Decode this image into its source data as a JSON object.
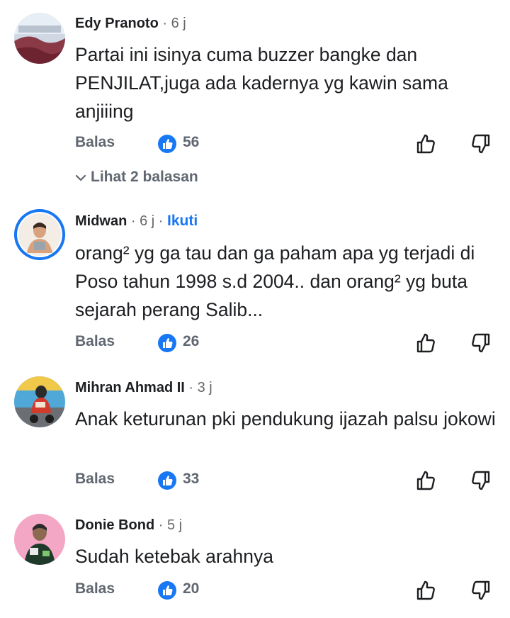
{
  "comments": [
    {
      "name": "Edy Pranoto",
      "time": "· 6 j",
      "text": "Partai ini isinya cuma buzzer bangke dan PENJILAT,juga ada kadernya yg kawin sama anjiiing",
      "reply_label": "Balas",
      "likes": "56",
      "avatar_icon": "avatar-landscape",
      "replies_link": "Lihat 2 balasan"
    },
    {
      "name": "Midwan",
      "time": "· 6 j ·",
      "follow_label": "Ikuti",
      "text": "orang² yg ga tau dan ga paham apa yg terjadi di Poso tahun 1998 s.d 2004.. dan orang² yg buta sejarah perang Salib...",
      "reply_label": "Balas",
      "likes": "26",
      "avatar_icon": "avatar-person"
    },
    {
      "name": "Mihran Ahmad II",
      "time": "· 3 j",
      "text": "Anak keturunan pki pendukung ijazah palsu jokowi",
      "reply_label": "Balas",
      "likes": "33",
      "avatar_icon": "avatar-rider"
    },
    {
      "name": "Donie Bond",
      "time": "· 5 j",
      "text": "Sudah ketebak arahnya",
      "reply_label": "Balas",
      "likes": "20",
      "avatar_icon": "avatar-person-pink"
    }
  ],
  "colors": {
    "accent": "#1877f2",
    "secondary_text": "#65676b",
    "primary_text": "#1c1e21"
  },
  "icons": {
    "like_badge": "thumbs-up-icon",
    "like_action": "thumbs-up-outline-icon",
    "dislike_action": "thumbs-down-outline-icon",
    "replies_chevron": "chevron-down-icon"
  }
}
